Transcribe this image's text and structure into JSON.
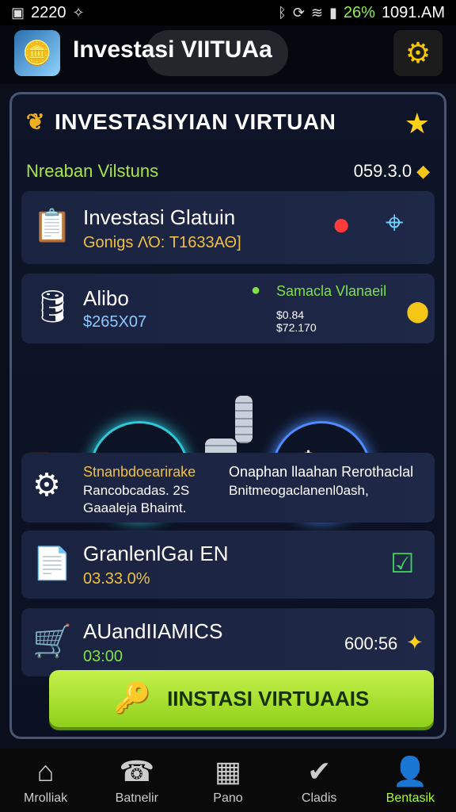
{
  "status_bar": {
    "left_time": "2220",
    "battery": "26%",
    "time": "1091.AM",
    "icons": [
      "gallery-icon",
      "signal-icon",
      "bluetooth-icon",
      "sync-icon",
      "wifi-icon",
      "signal-bars-icon"
    ]
  },
  "app_bar": {
    "title": "Investasi VIITUAa",
    "logo_icon": "coins-logo-icon",
    "settings_icon": "gear-icon"
  },
  "panel": {
    "title": "INVESTASIYIAN VIRTUAN",
    "title_icon": "leaf-icon",
    "star_icon": "star-icon",
    "sub_label": "Nreaban Vilstuns",
    "sub_value": "059.3.0",
    "cards": [
      {
        "title": "Investasi Glatuin",
        "sub": "Gonigs ΛΌ: T1633ΑΘ]",
        "icon": "chart-board-icon"
      },
      {
        "title": "Alibo",
        "sub": "$265X07",
        "icon": "database-icon",
        "right_title": "Samacla Vlanaeil",
        "right_lines": [
          "$0.84",
          "$72.170"
        ]
      },
      {
        "title_left": "Stnanbdoearirake",
        "lines_left": [
          "Rancobcadas. 2S",
          "Gaaaleja Bhaimt."
        ],
        "title_right": "Onaphan llaahan Rerothaclal",
        "lines_right": [
          "Bnitmeogaclanenl0ash,"
        ]
      },
      {
        "title": "GranlenlGaı EN",
        "sub": "03.33.0%",
        "icon": "document-icon"
      },
      {
        "title": "AUandIIAMICS",
        "sub": "03:00",
        "right_value": "600:56",
        "icon": "cart-icon"
      }
    ]
  },
  "cta": {
    "label": "IINSTASI VIRTUAAIS"
  },
  "nav": [
    {
      "label": "Mrolliak",
      "icon": "home-icon"
    },
    {
      "label": "Batnelir",
      "icon": "phone-icon"
    },
    {
      "label": "Pano",
      "icon": "calendar-icon"
    },
    {
      "label": "Cladis",
      "icon": "check-icon"
    },
    {
      "label": "Bentasik",
      "icon": "user-icon"
    }
  ],
  "colors": {
    "accent": "#9bdc1c",
    "yellow": "#f0c040",
    "bg": "#0b0f1c"
  }
}
